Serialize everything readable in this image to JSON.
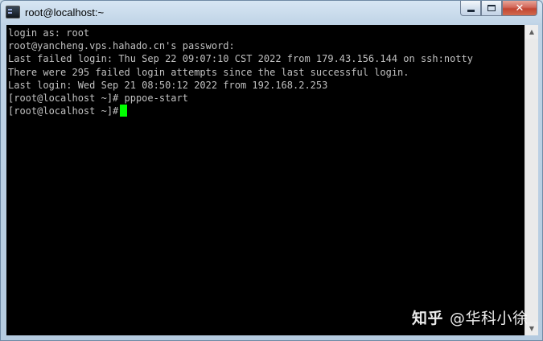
{
  "window": {
    "title": "root@localhost:~",
    "controls": {
      "minimize": "",
      "maximize": "",
      "close": "✕"
    }
  },
  "terminal": {
    "lines": [
      "login as: root",
      "root@yancheng.vps.hahado.cn's password:",
      "Last failed login: Thu Sep 22 09:07:10 CST 2022 from 179.43.156.144 on ssh:notty",
      "There were 295 failed login attempts since the last successful login.",
      "Last login: Wed Sep 21 08:50:12 2022 from 192.168.2.253",
      "[root@localhost ~]# pppoe-start"
    ],
    "prompt": "[root@localhost ~]#",
    "cursor_color": "#00ff00"
  },
  "scrollbar": {
    "up_arrow": "▲",
    "down_arrow": "▼"
  },
  "watermark": {
    "logo": "知乎",
    "author": "@华科小徐"
  }
}
